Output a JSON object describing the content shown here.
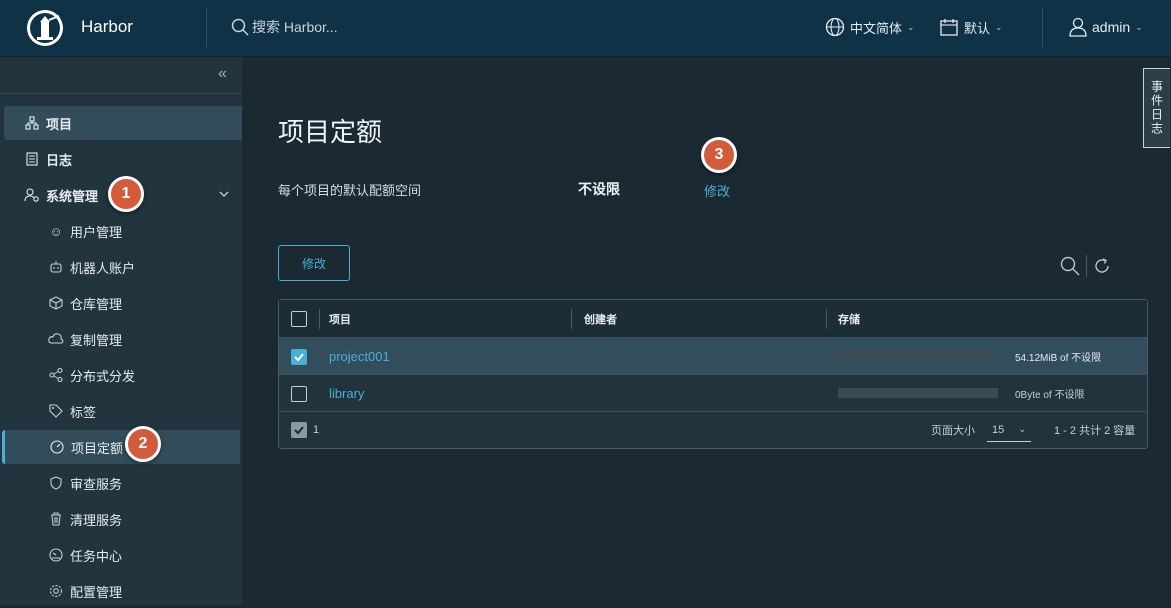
{
  "header": {
    "brand": "Harbor",
    "search_placeholder": "搜索 Harbor...",
    "language": "中文简体",
    "date_format": "默认",
    "user": "admin"
  },
  "sidebar": {
    "items": [
      {
        "label": "项目",
        "icon": "projects-icon"
      },
      {
        "label": "日志",
        "icon": "logs-icon"
      },
      {
        "label": "系统管理",
        "icon": "admin-icon"
      },
      {
        "label": "用户管理",
        "icon": "users-icon"
      },
      {
        "label": "机器人账户",
        "icon": "robot-icon"
      },
      {
        "label": "仓库管理",
        "icon": "registry-icon"
      },
      {
        "label": "复制管理",
        "icon": "replication-icon"
      },
      {
        "label": "分布式分发",
        "icon": "distribution-icon"
      },
      {
        "label": "标签",
        "icon": "tag-icon"
      },
      {
        "label": "项目定额",
        "icon": "quota-icon"
      },
      {
        "label": "审查服务",
        "icon": "interrogation-icon"
      },
      {
        "label": "清理服务",
        "icon": "trash-icon"
      },
      {
        "label": "任务中心",
        "icon": "job-icon"
      },
      {
        "label": "配置管理",
        "icon": "config-icon"
      }
    ]
  },
  "badges": [
    "1",
    "2",
    "3"
  ],
  "main": {
    "title": "项目定额",
    "default_quota_label": "每个项目的默认配额空间",
    "default_quota_value": "不设限",
    "edit_link": "修改",
    "edit_button": "修改"
  },
  "table": {
    "columns": [
      "项目",
      "创建者",
      "存储"
    ],
    "rows": [
      {
        "name": "project001",
        "creator": "",
        "quota": "54.12MiB of 不设限",
        "selected": true
      },
      {
        "name": "library",
        "creator": "",
        "quota": "0Byte of 不设限",
        "selected": false
      }
    ],
    "selected_count": "1",
    "page_size_label": "页面大小",
    "page_size": "15",
    "summary": "1 - 2 共计 2 容量"
  },
  "event_log_tab": "事件日志",
  "colors": {
    "header_bg": "#0f3247",
    "accent": "#49afd9",
    "badge": "#d35a3b"
  }
}
